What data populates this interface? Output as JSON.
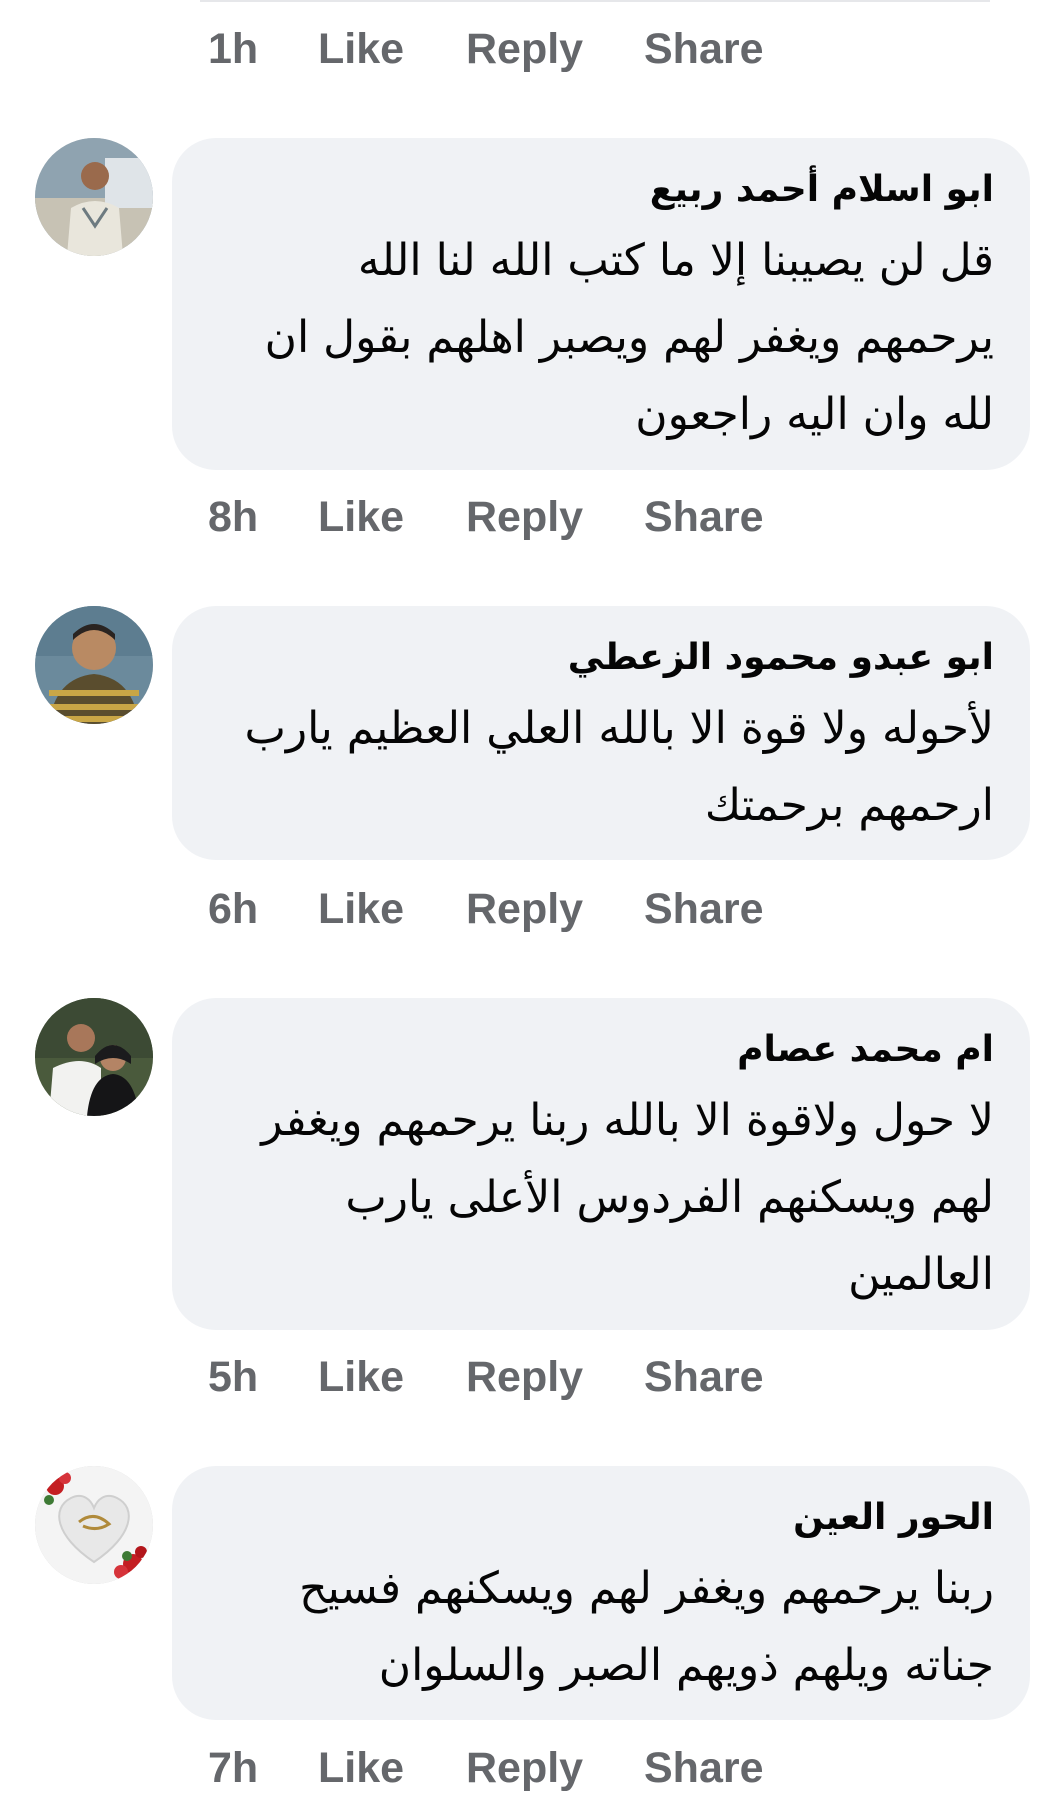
{
  "comments": [
    {
      "time": "1h",
      "like": "Like",
      "reply": "Reply",
      "share": "Share"
    },
    {
      "author": "ابو اسلام أحمد ربيع",
      "lines": [
        "قل لن يصيبنا إلا ما كتب الله لنا الله",
        "يرحمهم ويغفر لهم ويصبر اهلهم بقول ان",
        "لله وان اليه راجعون"
      ],
      "time": "8h",
      "like": "Like",
      "reply": "Reply",
      "share": "Share",
      "avatar": "man-outdoor-avatar"
    },
    {
      "author": "ابو عبدو محمود الزعطي",
      "lines": [
        "لأحوله ولا قوة الا بالله العلي العظيم يارب",
        "ارحمهم برحمتك"
      ],
      "time": "6h",
      "like": "Like",
      "reply": "Reply",
      "share": "Share",
      "avatar": "man-striped-shirt-avatar"
    },
    {
      "author": "ام محمد عصام",
      "lines": [
        "لا حول ولاقوة الا بالله ربنا يرحمهم ويغفر",
        "لهم ويسكنهم الفردوس الأعلى يارب",
        "العالمين"
      ],
      "time": "5h",
      "like": "Like",
      "reply": "Reply",
      "share": "Share",
      "avatar": "couple-photo-avatar"
    },
    {
      "author": "الحور العين",
      "lines": [
        "ربنا يرحمهم ويغفر لهم ويسكنهم فسيح",
        "جناته ويلهم ذويهم الصبر والسلوان"
      ],
      "time": "7h",
      "like": "Like",
      "reply": "Reply",
      "share": "Share",
      "avatar": "calligraphy-heart-roses-avatar"
    }
  ],
  "colors": {
    "bubble": "#f0f2f5",
    "meta_text": "#65676b",
    "body_text": "#050505"
  }
}
